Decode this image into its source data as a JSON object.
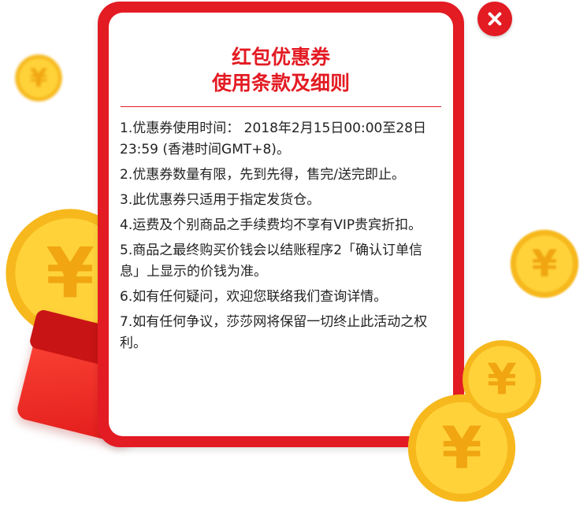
{
  "dialog": {
    "title_line1": "红包优惠券",
    "title_line2": "使用条款及细则",
    "terms": [
      "1.优惠券使用时间：  2018年2月15日00:00至28日23:59 (香港时间GMT+8)。",
      "2.优惠券数量有限，先到先得，售完/送完即止。",
      "3.此优惠券只适用于指定发货仓。",
      "4.运费及个别商品之手续费均不享有VIP贵宾折扣。",
      "5.商品之最终购买价钱会以结账程序2「确认订单信息」上显示的价钱为准。",
      "6.如有任何疑问，欢迎您联络我们查询详情。",
      "7.如有任何争议，莎莎网将保留一切终止此活动之权利。"
    ]
  },
  "icons": {
    "close": "close-icon",
    "coin": "yuan-coin-icon",
    "envelope": "red-envelope-icon"
  },
  "colors": {
    "accent": "#e31b23",
    "coin_gold": "#ffd23a",
    "text": "#222222"
  }
}
